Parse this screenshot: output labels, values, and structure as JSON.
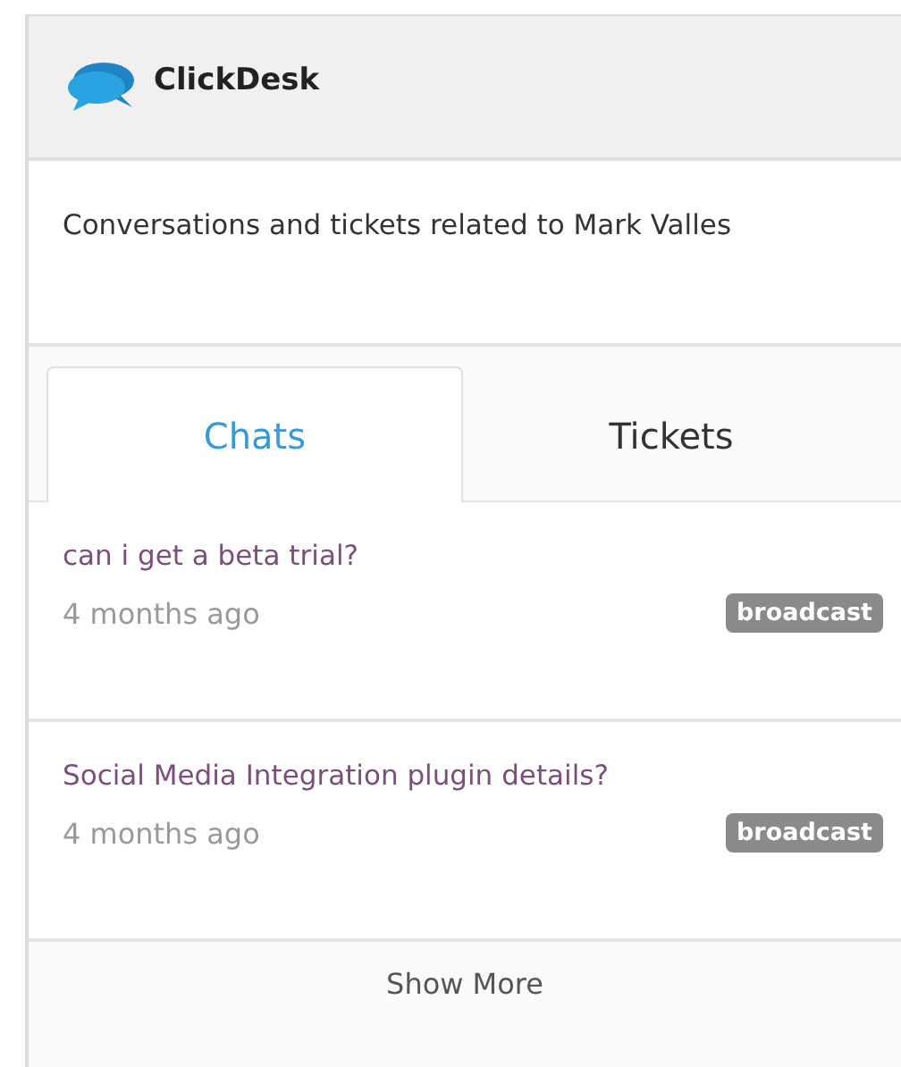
{
  "header": {
    "title": "ClickDesk"
  },
  "description": "Conversations and tickets related to Mark Valles",
  "tabs": [
    {
      "label": "Chats",
      "selected": true
    },
    {
      "label": "Tickets",
      "selected": false
    }
  ],
  "conversations": [
    {
      "subject": "can i get a beta trial?",
      "time": "4 months ago",
      "tag": "broadcast"
    },
    {
      "subject": "Social Media Integration plugin details?",
      "time": "4 months ago",
      "tag": "broadcast"
    }
  ],
  "show_more": "Show More"
}
